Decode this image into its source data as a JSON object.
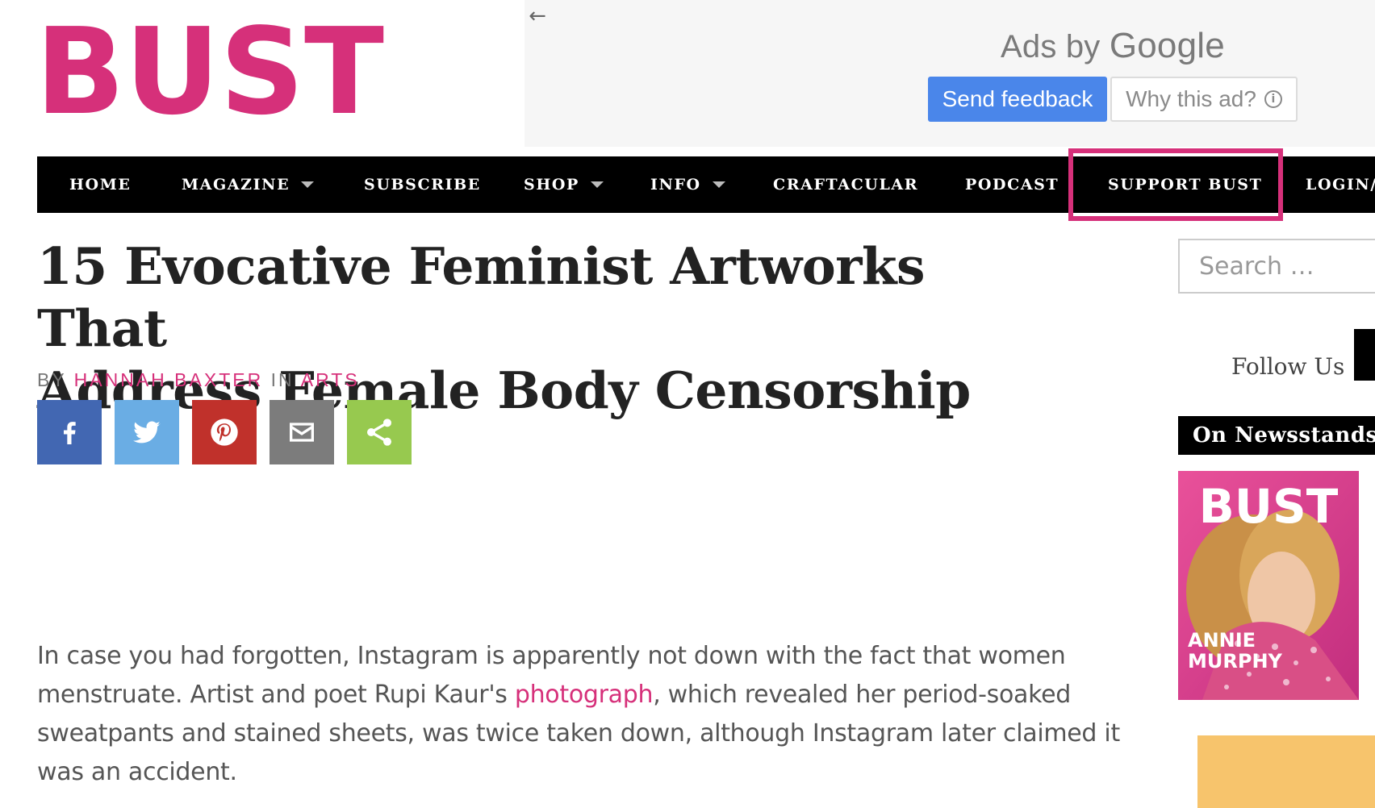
{
  "logo_text": "BUST",
  "ad": {
    "back_icon": "arrow-left-icon",
    "ads_by_prefix": "Ads by",
    "ads_by_brand": "Google",
    "feedback_label": "Send feedback",
    "why_label": "Why this ad?",
    "info_icon": "ⓘ"
  },
  "nav": {
    "items": [
      {
        "label": "HOME"
      },
      {
        "label": "MAGAZINE"
      },
      {
        "label": "SUBSCRIBE"
      },
      {
        "label": "SHOP"
      },
      {
        "label": "INFO"
      },
      {
        "label": "CRAFTACULAR"
      },
      {
        "label": "PODCAST"
      },
      {
        "label": "SUPPORT BUST"
      },
      {
        "label": "LOGIN/I"
      }
    ],
    "highlight_color": "#d6307a"
  },
  "article": {
    "title_line1": "15 Evocative Feminist Artworks That",
    "title_line2": "Address Female Body Censorship",
    "by_label": "BY",
    "author": "HANNAH BAXTER",
    "in_label": "IN",
    "category": "ARTS",
    "share": [
      {
        "name": "facebook",
        "color": "#4267b2"
      },
      {
        "name": "twitter",
        "color": "#6aade4"
      },
      {
        "name": "pinterest",
        "color": "#c0312b"
      },
      {
        "name": "email",
        "color": "#7c7c7c"
      },
      {
        "name": "share",
        "color": "#97c94f"
      }
    ],
    "body_before_link": "In case you had forgotten, Instagram is apparently not down with the fact that women menstruate. Artist and poet Rupi Kaur's ",
    "body_link": "photograph",
    "body_after_link": ", which revealed her period-soaked sweatpants and stained sheets, was twice taken down, although Instagram later claimed it was an accident."
  },
  "sidebar": {
    "search_placeholder": "Search …",
    "follow_label": "Follow Us",
    "newsstands_label": "On Newsstands",
    "cover_logo": "BUST",
    "cover_name_line1": "ANNIE",
    "cover_name_line2": "MURPHY"
  }
}
